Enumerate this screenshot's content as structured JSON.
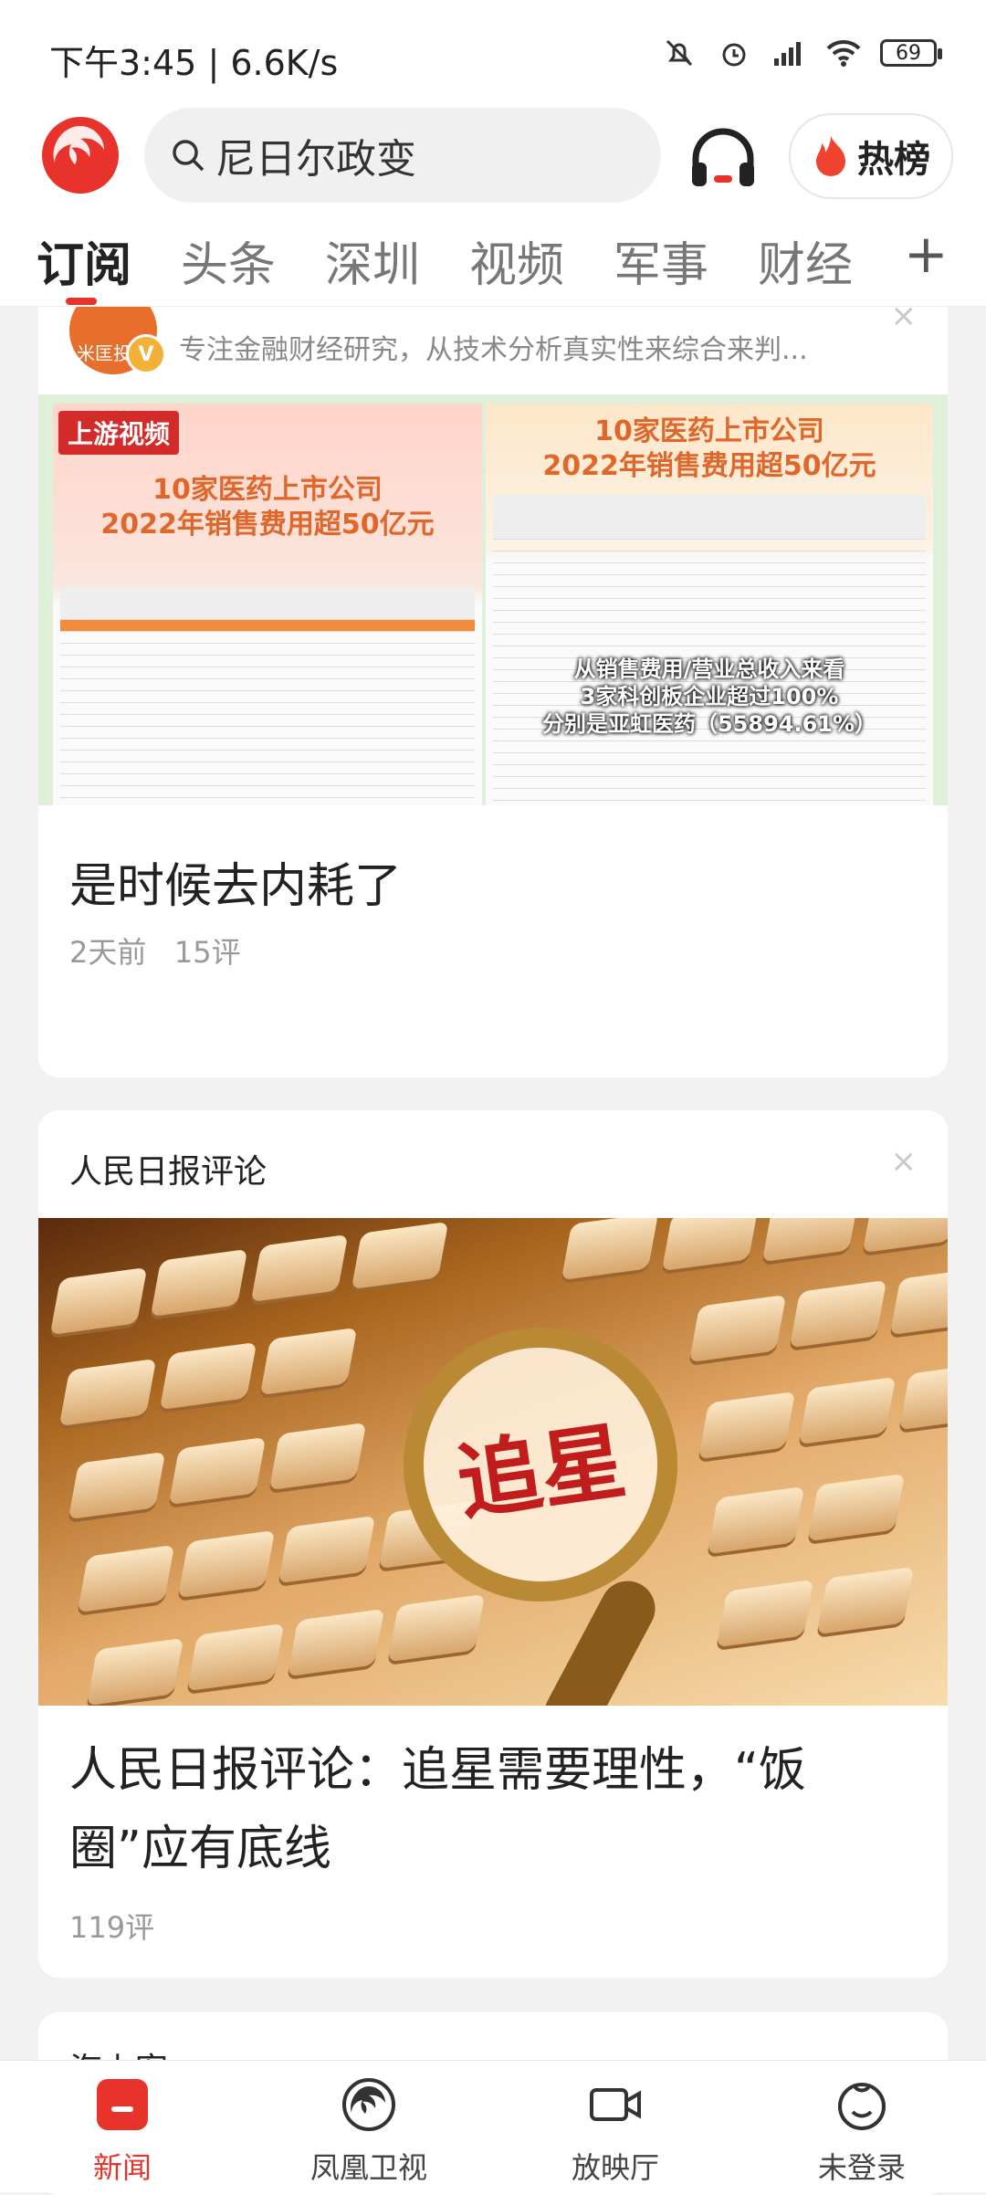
{
  "status_bar": {
    "time": "下午3:45",
    "speed": "6.6K/s",
    "battery": "69"
  },
  "header": {
    "search_text": "尼日尔政变",
    "hot_label": "热榜"
  },
  "tabs": [
    {
      "label": "订阅"
    },
    {
      "label": "头条"
    },
    {
      "label": "深圳"
    },
    {
      "label": "视频"
    },
    {
      "label": "军事"
    },
    {
      "label": "财经"
    }
  ],
  "tab_plus": "+",
  "card1": {
    "source_desc": "专注金融财经研究，从技术分析真实性来综合来判...",
    "avatar_text": "米匡投资",
    "image": {
      "brand": "上游视频",
      "left_title_1": "10家医药上市公司",
      "left_title_2": "2022年销售费用超50亿元",
      "right_title_1": "10家医药上市公司",
      "right_title_2": "2022年销售费用超50亿元",
      "overlay_1": "从销售费用/营业总收入来看",
      "overlay_2": "3家科创板企业超过100%",
      "overlay_3": "分别是亚虹医药（55894.61%）"
    },
    "title": "是时候去内耗了",
    "time": "2天前",
    "comments": "15评"
  },
  "card2": {
    "source_name": "人民日报评论",
    "image_text": "追星",
    "title_line1": "人民日报评论：追星需要理性，“饭",
    "title_line2": "圈”应有底线",
    "comments": "119评"
  },
  "card3": {
    "source_name": "海上客"
  },
  "bottom_nav": [
    {
      "label": "新闻"
    },
    {
      "label": "凤凰卫视"
    },
    {
      "label": "放映厅"
    },
    {
      "label": "未登录"
    }
  ],
  "colors": {
    "accent": "#e8332c",
    "brand_red": "#d32a2a"
  }
}
